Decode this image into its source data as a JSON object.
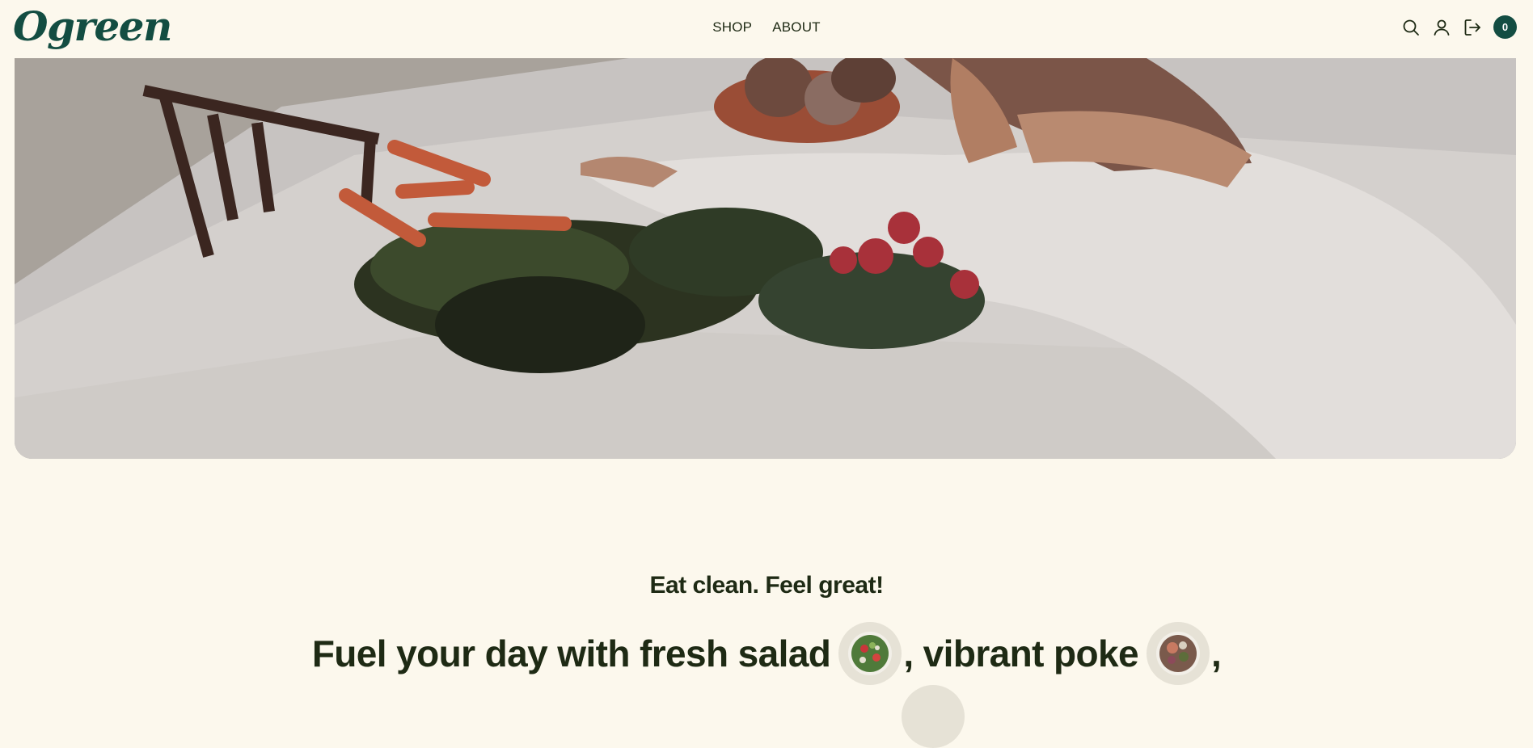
{
  "header": {
    "logo": "Ogreen",
    "nav": [
      {
        "label": "SHOP"
      },
      {
        "label": "ABOUT"
      }
    ],
    "icons": [
      "search-icon",
      "user-icon",
      "logout-icon"
    ],
    "cart_count": "0"
  },
  "hero": {
    "image": "woman resting at table with fresh carrots and radishes"
  },
  "intro": {
    "tagline": "Eat clean. Feel great!",
    "headline_part1": "Fuel your day with fresh salad",
    "headline_part2": ", vibrant poke",
    "headline_part3": ","
  },
  "colors": {
    "brand": "#134d42",
    "background": "#fcf8ed",
    "text": "#1e2a14"
  }
}
